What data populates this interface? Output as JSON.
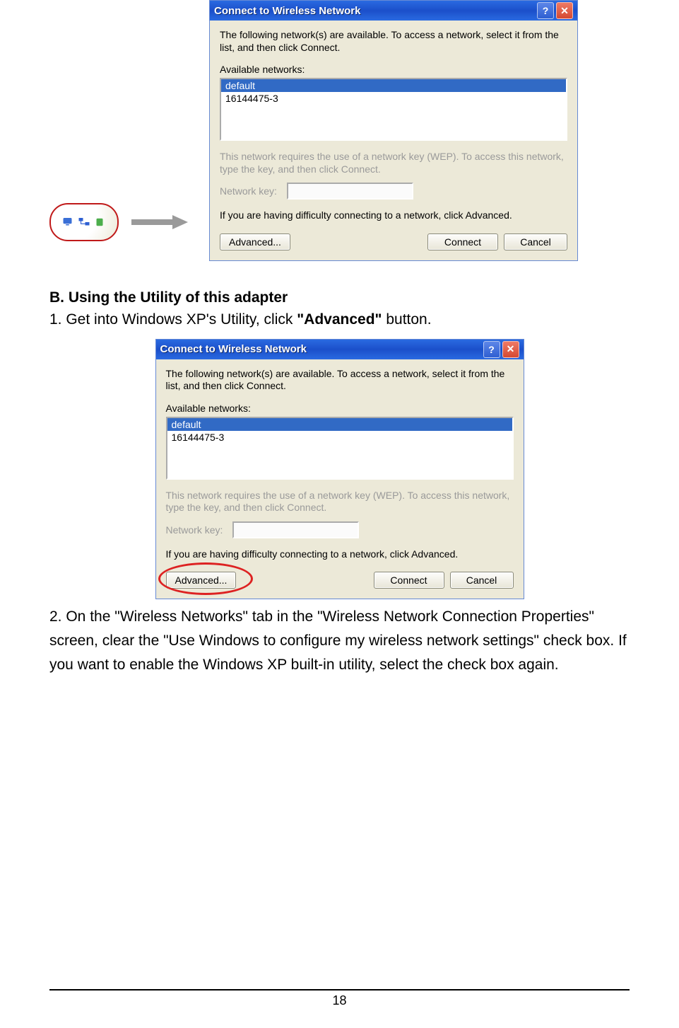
{
  "page_number": "18",
  "dialog": {
    "title": "Connect to Wireless Network",
    "intro": "The following network(s) are available. To access a network, select it from the list, and then click Connect.",
    "available_label": "Available networks:",
    "networks": [
      "default",
      "16144475-3"
    ],
    "wep_note": "This network requires the use of a network key (WEP). To access this network, type the key, and then click Connect.",
    "netkey_label": "Network key:",
    "difficulty_line": "If you are having difficulty connecting to a network, click Advanced.",
    "buttons": {
      "advanced": "Advanced...",
      "connect": "Connect",
      "cancel": "Cancel"
    }
  },
  "section_b_heading": "B. Using the Utility of this adapter",
  "step1_pre": "1. Get into Windows XP's Utility, click ",
  "step1_bold": "\"Advanced\"",
  "step1_post": " button.",
  "step2_pre": "2. On the ",
  "step2_b1": "\"Wireless Networks\"",
  "step2_mid1": " tab in the ",
  "step2_b2": "\"Wireless Network Connection Properties\"",
  "step2_mid2": " screen, clear the \"Use Windows to configure my wireless network settings\" check box. If you want to enable the Windows XP built-in utility, select the check box again."
}
